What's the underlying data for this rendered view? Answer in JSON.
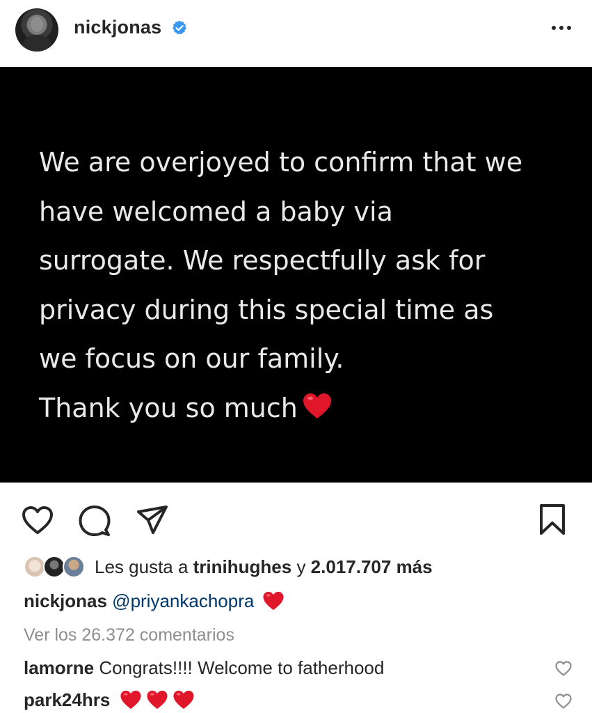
{
  "header": {
    "username": "nickjonas",
    "verified": true,
    "avatar_icon": "profile-avatar",
    "more_icon": "more-horizontal-icon"
  },
  "post": {
    "background": "#000000",
    "text": "We are overjoyed to confirm that we\nhave welcomed a baby via\nsurrogate. We respectfully ask for\nprivacy during this special time as\nwe focus on our family.\nThank you so much",
    "trailing_emoji": "red-heart"
  },
  "actions": {
    "like_icon": "heart-outline-icon",
    "comment_icon": "comment-bubble-icon",
    "share_icon": "paper-plane-icon",
    "save_icon": "bookmark-icon"
  },
  "likes": {
    "prefix": "Les gusta a ",
    "user": "trinihughes",
    "connector": " y ",
    "count": "2.017.707 más"
  },
  "caption": {
    "user": "nickjonas",
    "mention": "@priyankachopra",
    "emoji": "red-heart"
  },
  "view_comments": "Ver los 26.372 comentarios",
  "comments": [
    {
      "user": "lamorne",
      "text": "Congrats!!!! Welcome to fatherhood"
    },
    {
      "user": "park24hrs",
      "text": "",
      "emojis": [
        "red-heart",
        "red-heart",
        "red-heart"
      ]
    }
  ],
  "colors": {
    "text": "#262626",
    "muted": "#8e8e8e",
    "mention": "#00376b",
    "verified": "#3897f0",
    "heart": "#e0162b"
  }
}
